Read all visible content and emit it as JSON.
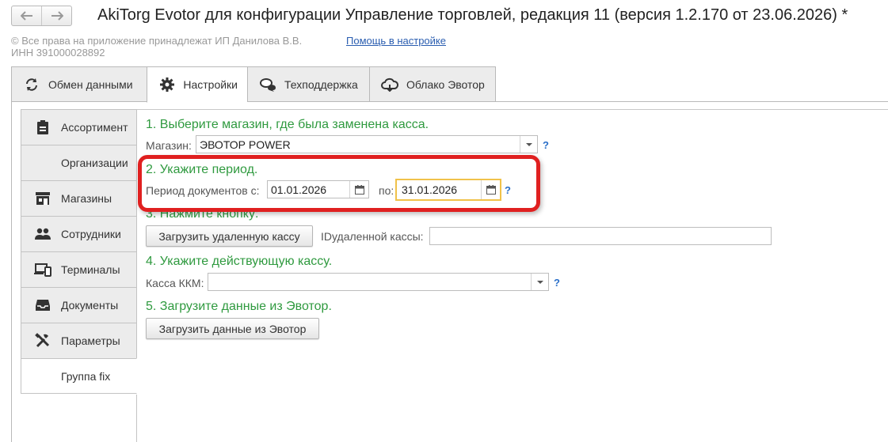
{
  "header": {
    "title": "AkiTorg Evotor для конфигурации Управление торговлей, редакция 11 (версия 1.2.170 от 23.06.2026) *",
    "back_glyph": "🡐",
    "forward_glyph": "🡒"
  },
  "info": {
    "copyright": "© Все права на приложение принадлежат ИП Данилова В.В.",
    "inn": "ИНН 391000028892",
    "help_link": "Помощь в настройке"
  },
  "tabs": [
    {
      "label": "Обмен данными",
      "icon": "sync-icon"
    },
    {
      "label": "Настройки",
      "icon": "gear-icon",
      "active": true
    },
    {
      "label": "Техподдержка",
      "icon": "chat-icon"
    },
    {
      "label": "Облако Эвотор",
      "icon": "cloud-icon"
    }
  ],
  "sidebar": [
    {
      "label": "Ассортимент",
      "icon": "clipboard-icon"
    },
    {
      "label": "Организации",
      "icon": ""
    },
    {
      "label": "Магазины",
      "icon": "store-icon"
    },
    {
      "label": "Сотрудники",
      "icon": "people-icon"
    },
    {
      "label": "Терминалы",
      "icon": "devices-icon"
    },
    {
      "label": "Документы",
      "icon": "inbox-icon"
    },
    {
      "label": "Параметры",
      "icon": "tools-icon"
    },
    {
      "label": "Группа fix",
      "icon": "",
      "active": true
    }
  ],
  "form": {
    "step1": "1. Выберите магазин, где была заменена касса.",
    "store_label": "Магазин:",
    "store_value": "ЭВОТОР POWER",
    "step2": "2. Укажите период.",
    "period_label": "Период  документов с:",
    "date_from": "01.01.2026",
    "to_label": "по:",
    "date_to": "31.01.2026",
    "step3": "3. Нажмите кнопку:",
    "load_remote_button": "Загрузить удаленную кассу",
    "remote_id_label": "IDудаленной кассы:",
    "remote_id_value": "",
    "step4": "4. Укажите действующую кассу.",
    "kkm_label": "Касса ККМ:",
    "kkm_value": "",
    "step5": "5. Загрузите данные из Эвотор.",
    "load_evotor_button": "Загрузить данные из Эвотор",
    "help_mark": "?"
  },
  "colors": {
    "step_text": "#2f9a3f",
    "highlight": "#e02020",
    "focus_border": "#f0c24a",
    "link": "#2a5db0"
  }
}
